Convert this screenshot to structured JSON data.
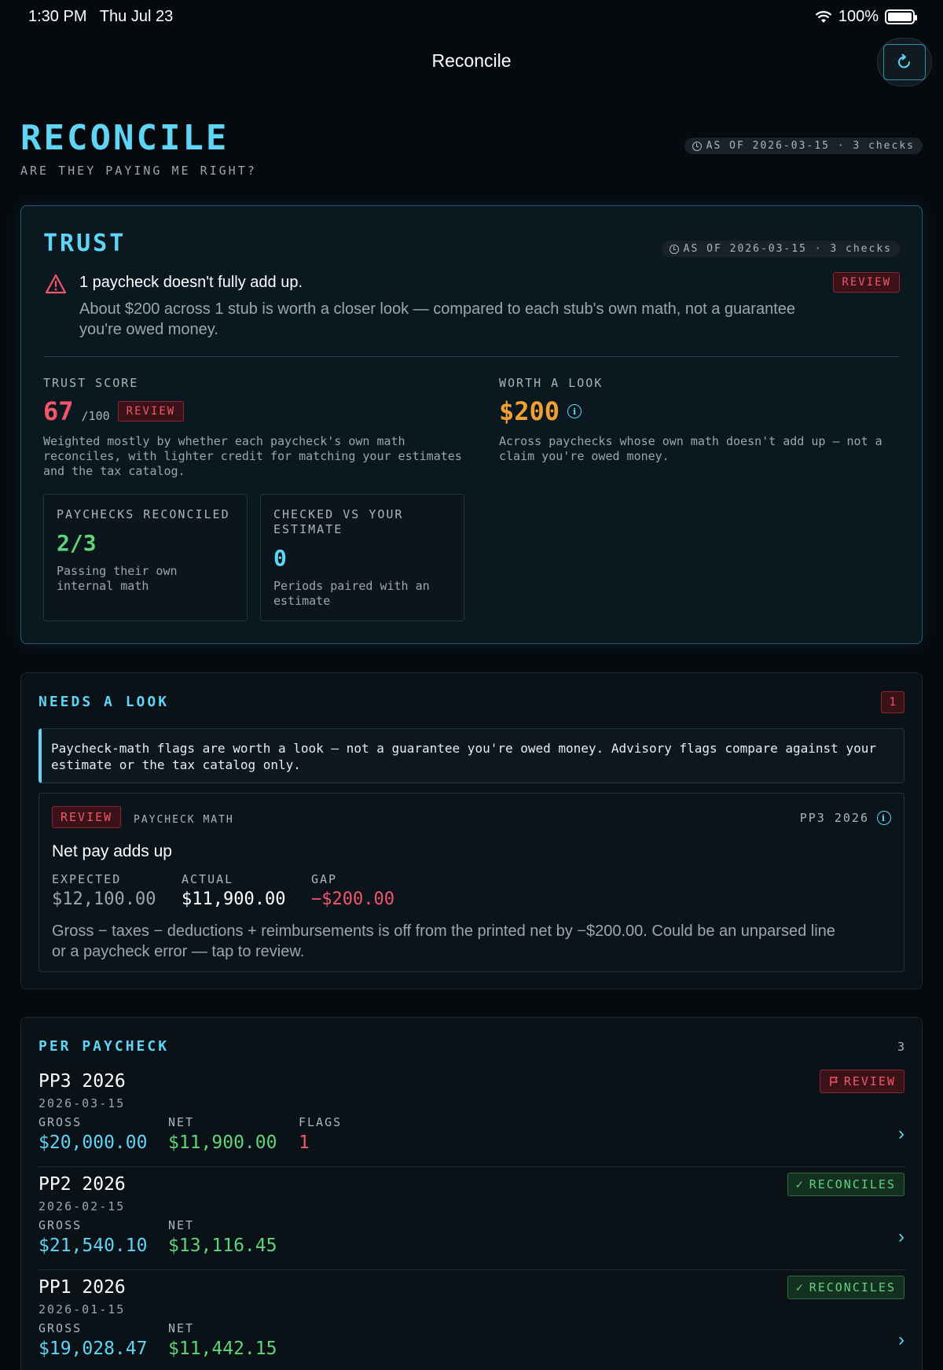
{
  "status_bar": {
    "time": "1:30 PM",
    "date": "Thu Jul 23",
    "battery": "100%"
  },
  "nav": {
    "title": "Reconcile",
    "refresh_icon": "refresh-icon"
  },
  "header": {
    "title": "RECONCILE",
    "subtitle": "ARE THEY PAYING ME RIGHT?",
    "as_of": "AS OF 2026-03-15 · 3 checks"
  },
  "trust": {
    "title": "TRUST",
    "as_of": "AS OF 2026-03-15 · 3 checks",
    "alert_title": "1 paycheck doesn't fully add up.",
    "alert_desc": "About $200 across 1 stub is worth a closer look — compared to each stub's own math, not a guarantee you're owed money.",
    "alert_badge": "REVIEW",
    "score_label": "TRUST SCORE",
    "score": "67",
    "score_den": "/100",
    "score_badge": "REVIEW",
    "score_desc": "Weighted mostly by whether each paycheck's own math reconciles, with lighter credit for matching your estimates and the tax catalog.",
    "worth_label": "WORTH A LOOK",
    "worth_value": "$200",
    "worth_desc": "Across paychecks whose own math doesn't add up — not a claim you're owed money.",
    "stat1": {
      "label": "PAYCHECKS RECONCILED",
      "value": "2/3",
      "desc": "Passing their own internal math"
    },
    "stat2": {
      "label": "CHECKED VS YOUR ESTIMATE",
      "value": "0",
      "desc": "Periods paired with an estimate"
    }
  },
  "needs": {
    "title": "NEEDS A LOOK",
    "count": "1",
    "note": "Paycheck-math flags are worth a look — not a guarantee you're owed money. Advisory flags compare against your estimate or the tax catalog only.",
    "flag": {
      "badge": "REVIEW",
      "category": "PAYCHECK MATH",
      "period": "PP3 2026",
      "title": "Net pay adds up",
      "expected_label": "EXPECTED",
      "expected": "$12,100.00",
      "actual_label": "ACTUAL",
      "actual": "$11,900.00",
      "gap_label": "GAP",
      "gap": "−$200.00",
      "desc": "Gross − taxes − deductions + reimbursements is off from the printed net by −$200.00. Could be an unparsed line or a paycheck error — tap to review."
    }
  },
  "per_paycheck": {
    "title": "PER PAYCHECK",
    "count": "3",
    "rows": [
      {
        "name": "PP3 2026",
        "date": "2026-03-15",
        "gross_label": "GROSS",
        "gross": "$20,000.00",
        "net_label": "NET",
        "net": "$11,900.00",
        "flags_label": "FLAGS",
        "flags": "1",
        "badge": "REVIEW"
      },
      {
        "name": "PP2 2026",
        "date": "2026-02-15",
        "gross_label": "GROSS",
        "gross": "$21,540.10",
        "net_label": "NET",
        "net": "$13,116.45",
        "badge": "RECONCILES"
      },
      {
        "name": "PP1 2026",
        "date": "2026-01-15",
        "gross_label": "GROSS",
        "gross": "$19,028.47",
        "net_label": "NET",
        "net": "$11,442.15",
        "badge": "RECONCILES"
      }
    ]
  },
  "colors": {
    "accent": "#5fd4f4",
    "danger": "#f25668",
    "warning": "#f0a030",
    "success": "#5fd47a",
    "background": "#060a0f"
  }
}
